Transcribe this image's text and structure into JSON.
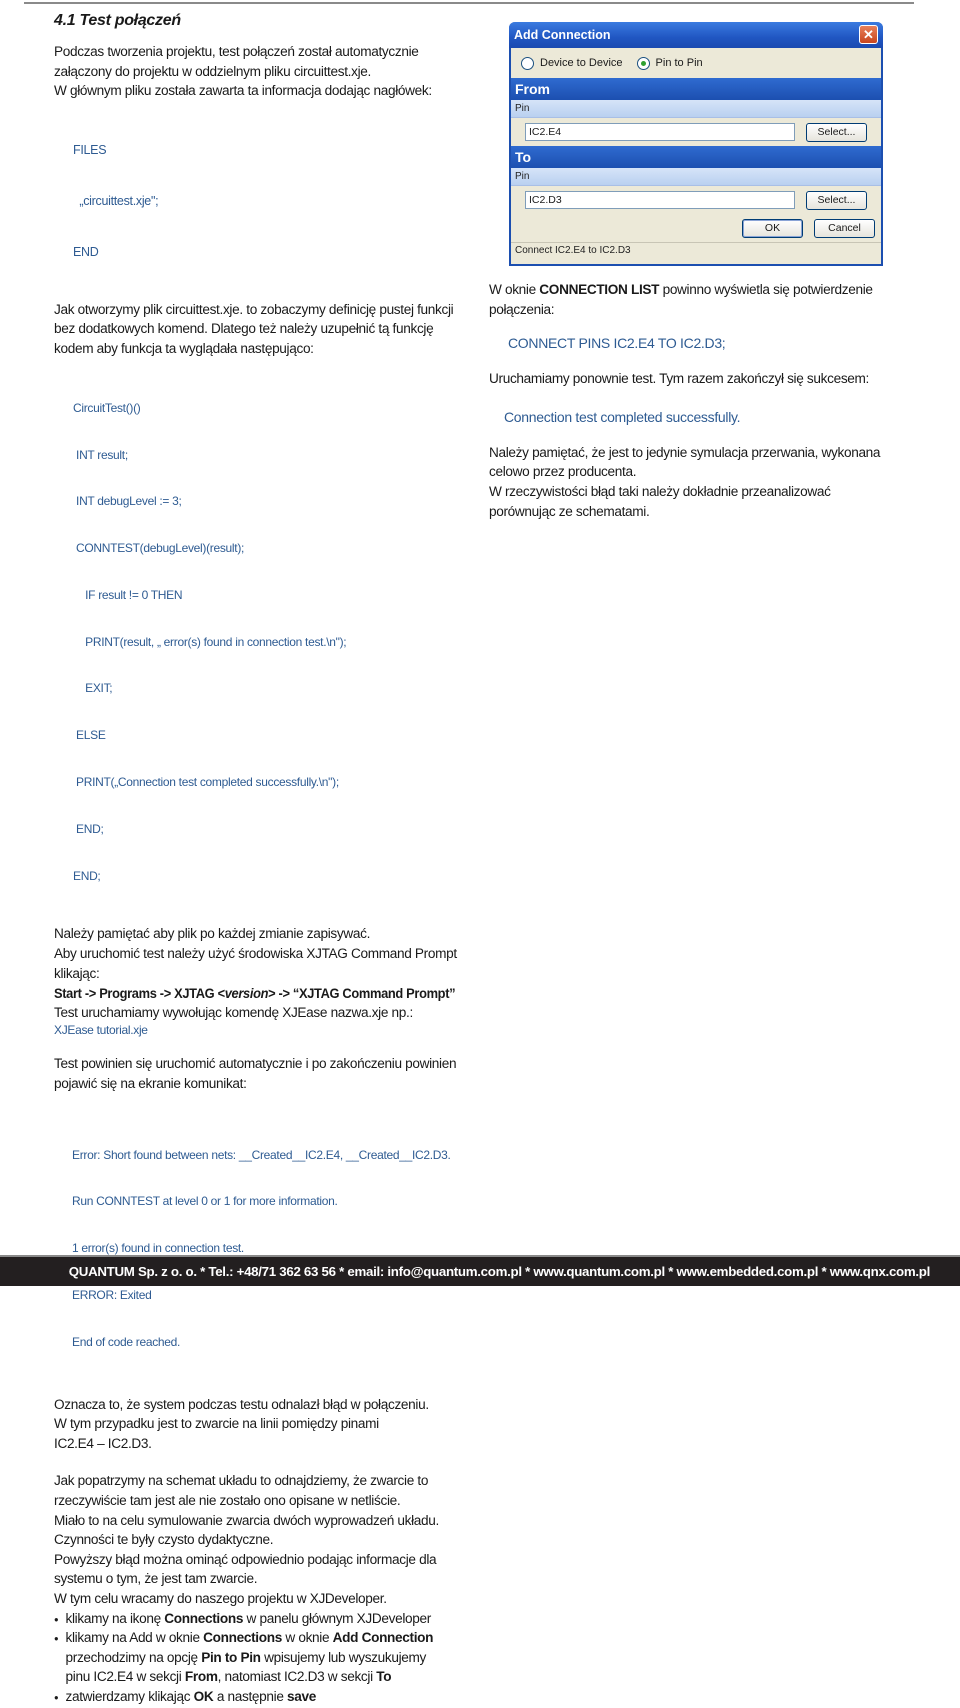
{
  "heading": "4.1 Test połączeń",
  "left": {
    "intro": [
      "Podczas tworzenia projektu, test połączeń został automatycznie",
      "załączony do projektu w oddzielnym pliku circuittest.xje.",
      "W głównym pliku została zawarta ta informacja dodając nagłówek:"
    ],
    "files_code": [
      "FILES",
      "  „circuittest.xje\";",
      "END"
    ],
    "para2": [
      "Jak otworzymy plik circuittest.xje. to zobaczymy definicję pustej funkcji",
      "bez dodatkowych komend. Dlatego też należy uzupełnić tą funkcję",
      "kodem aby funkcja ta wyglądała następująco:"
    ],
    "function_code": [
      "CircuitTest()()",
      " INT result;",
      " INT debugLevel := 3;",
      " CONNTEST(debugLevel)(result);",
      "    IF result != 0 THEN",
      "    PRINT(result, „ error(s) found in connection test.\\n\");",
      "    EXIT;",
      " ELSE",
      " PRINT(„Connection test completed successfully.\\n\");",
      " END;",
      "END;"
    ],
    "para3": [
      "Należy pamiętać aby plik po każdej zmianie zapisywać.",
      "Aby uruchomić test należy użyć środowiska XJTAG Command Prompt",
      "klikając:"
    ],
    "menu_path": {
      "before": "Start -> Programs -> XJTAG <",
      "version": "version",
      "after": "> -> “XJTAG Command Prompt”"
    },
    "para4": "Test uruchamiamy wywołując komendę XJEase nazwa.xje np.:",
    "example_cmd": "XJEase tutorial.xje",
    "para5": [
      "Test powinien się uruchomić automatycznie i po zakończeniu powinien",
      "pojawić się na ekranie komunikat:"
    ],
    "error_output": [
      "Error: Short found between nets: __Created__IC2.E4, __Created__IC2.D3.",
      "Run CONNTEST at level 0 or 1 for more information.",
      "1 error(s) found in connection test.",
      "ERROR: Exited",
      "End of code reached."
    ],
    "para6": [
      "Oznacza to, że system podczas testu odnalazł błąd w połączeniu.",
      "W tym przypadku jest to zwarcie na linii pomiędzy pinami",
      "IC2.E4 – IC2.D3."
    ],
    "para7": [
      "Jak popatrzymy na schemat układu to odnajdziemy, że zwarcie to",
      "rzeczywiście tam jest ale nie zostało ono opisane w netliście.",
      "Miało to na celu symulowanie zwarcia dwóch wyprowadzeń układu.",
      "Czynności te były czysto dydaktyczne.",
      "Powyższy błąd można ominąć odpowiednio podając informacje dla",
      "systemu o tym, że jest tam zwarcie.",
      "W tym celu wracamy do naszego projektu w XJDeveloper."
    ],
    "bullets": {
      "b1": {
        "t1": "klikamy na ikonę ",
        "b1": "Connections",
        "t2": " w panelu głównym XJDeveloper"
      },
      "b2": {
        "t1": "klikamy na Add w oknie ",
        "b1": "Connections",
        "t2": "  w oknie ",
        "b2": "Add Connection",
        "c1": "przechodzimy na opcję ",
        "cb1": "Pin to Pin",
        "c2": " wpisujemy lub wyszukujemy",
        "d1": "pinu IC2.E4 w sekcji ",
        "db1": "From",
        "d2": ", natomiast IC2.D3 w sekcji ",
        "db2": "To"
      },
      "b3": {
        "t1": "zatwierdzamy klikając ",
        "b1": "OK",
        "t2": " a następnie ",
        "b2": "save"
      }
    }
  },
  "dialog": {
    "title": "Add Connection",
    "close_glyph": "✕",
    "radio_options": [
      {
        "label": "Device to Device",
        "selected": false
      },
      {
        "label": "Pin to Pin",
        "selected": true
      }
    ],
    "from_label": "From",
    "to_label": "To",
    "pin_label": "Pin",
    "from_value": "IC2.E4",
    "to_value": "IC2.D3",
    "select_label": "Select...",
    "ok_label": "OK",
    "cancel_label": "Cancel",
    "status": "Connect IC2.E4 to IC2.D3"
  },
  "right": {
    "p1_a": "W oknie ",
    "p1_b": "CONNECTION LIST",
    "p1_c": " powinno wyświetla się potwierdzenie",
    "p1_d": "połączenia:",
    "connect_code": "CONNECT PINS IC2.E4 TO IC2.D3;",
    "p2": "Uruchamiamy ponownie test. Tym razem zakończył się sukcesem:",
    "success_code": "Connection test completed successfully.",
    "p3": [
      "Należy pamiętać, że jest to jedynie symulacja przerwania, wykonana",
      "celowo przez producenta.",
      "W rzeczywistości błąd taki należy dokładnie przeanalizować",
      "porównując ze schematami."
    ]
  },
  "footer": "QUANTUM Sp. z o. o. * Tel.: +48/71 362 63 56 * email: info@quantum.com.pl * www.quantum.com.pl * www.embedded.com.pl * www.qnx.com.pl",
  "colors": {
    "code_blue": "#2e5b92",
    "dialog_blue": "#1c4fb0",
    "footer_bg": "#231f20"
  }
}
